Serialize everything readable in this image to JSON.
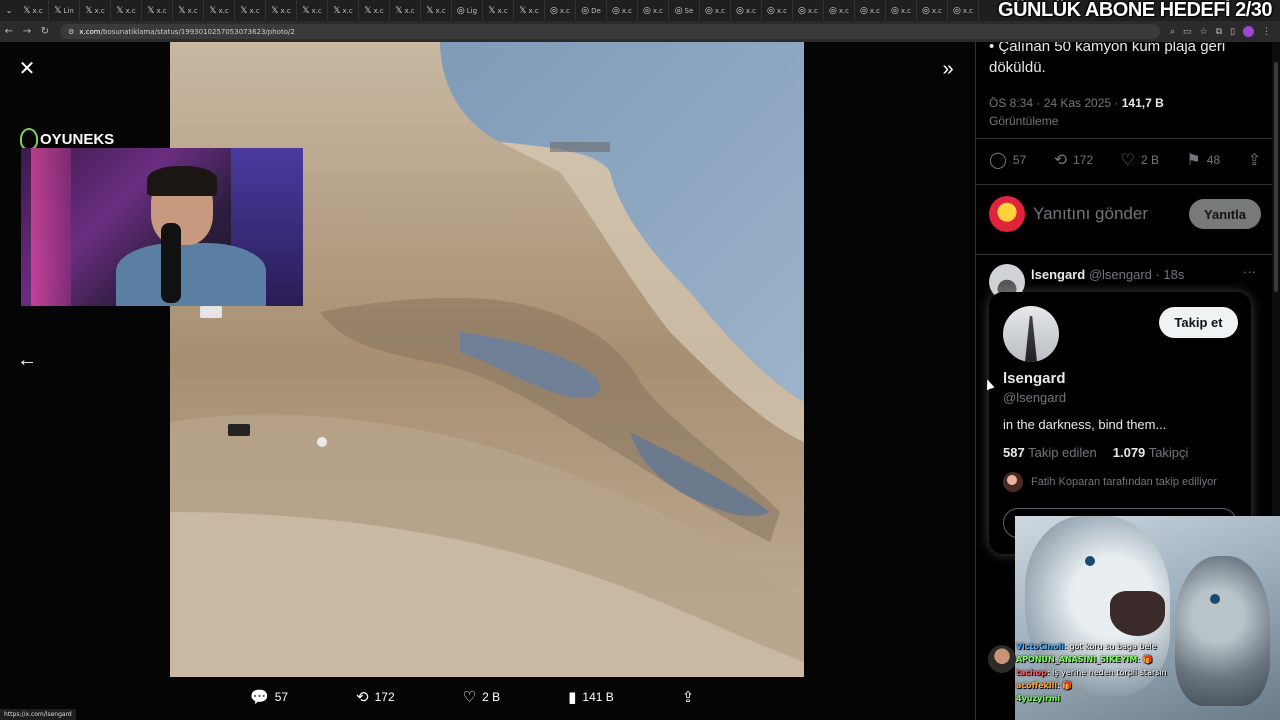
{
  "browser": {
    "tabs": [
      {
        "icon": "x-icon",
        "label": "x.c"
      },
      {
        "icon": "x-icon",
        "label": "Lin"
      },
      {
        "icon": "x-icon",
        "label": "x.c"
      },
      {
        "icon": "x-icon",
        "label": "x.c"
      },
      {
        "icon": "x-icon",
        "label": "x.c"
      },
      {
        "icon": "x-icon",
        "label": "x.c"
      },
      {
        "icon": "x-icon",
        "label": "x.c"
      },
      {
        "icon": "x-icon",
        "label": "x.c"
      },
      {
        "icon": "x-icon",
        "label": "x.c"
      },
      {
        "icon": "x-icon",
        "label": "x.c"
      },
      {
        "icon": "x-icon",
        "label": "x.c"
      },
      {
        "icon": "x-icon",
        "label": "x.c"
      },
      {
        "icon": "x-icon",
        "label": "x.c"
      },
      {
        "icon": "x-icon",
        "label": "x.c"
      },
      {
        "icon": "globe-icon",
        "label": "Lig"
      },
      {
        "icon": "x-icon",
        "label": "x.c"
      },
      {
        "icon": "x-icon",
        "label": "x.c"
      },
      {
        "icon": "globe-icon",
        "label": "x.c"
      },
      {
        "icon": "globe-icon",
        "label": "De"
      },
      {
        "icon": "globe-icon",
        "label": "x.c"
      },
      {
        "icon": "globe-icon",
        "label": "x.c"
      },
      {
        "icon": "globe-icon",
        "label": "Se"
      },
      {
        "icon": "globe-icon",
        "label": "x.c"
      },
      {
        "icon": "globe-icon",
        "label": "x.c"
      },
      {
        "icon": "globe-icon",
        "label": "x.c"
      },
      {
        "icon": "globe-icon",
        "label": "x.c"
      },
      {
        "icon": "globe-icon",
        "label": "x.c"
      },
      {
        "icon": "globe-icon",
        "label": "x.c"
      },
      {
        "icon": "globe-icon",
        "label": "x.c"
      },
      {
        "icon": "globe-icon",
        "label": "x.c"
      },
      {
        "icon": "globe-icon",
        "label": "x.c"
      }
    ],
    "url_host": "x.com",
    "url_path": "/bosunatiklama/status/1993010257053073623/photo/2",
    "status_url": "https://x.com/lsengard"
  },
  "stream_overlay": {
    "goal_banner": "GÜNLÜK ABONE HEDEFİ 2/30",
    "logo_text": "OYUNEKS"
  },
  "viewer": {
    "actions": [
      {
        "icon": "reply-icon",
        "glyph": "💬",
        "count": "57"
      },
      {
        "icon": "retweet-icon",
        "glyph": "⟲",
        "count": "172"
      },
      {
        "icon": "like-icon",
        "glyph": "♡",
        "count": "2 B"
      },
      {
        "icon": "views-icon",
        "glyph": "▮",
        "count": "141 B"
      },
      {
        "icon": "share-icon",
        "glyph": "⇪",
        "count": ""
      }
    ]
  },
  "tweet": {
    "text": "• Çalınan 50 kamyon kum plaja geri döküldü.",
    "time": "ÖS 8:34 · 24 Kas 2025 · ",
    "views_count": "141,7 B",
    "views_label": "Görüntüleme",
    "stats": {
      "replies": "57",
      "retweets": "172",
      "likes": "2 B",
      "bookmarks": "48"
    },
    "reply_placeholder": "Yanıtını gönder",
    "reply_button": "Yanıtla"
  },
  "reply": {
    "name": "lsengard",
    "handle": "@lsengard · 18s",
    "more": "···"
  },
  "hovercard": {
    "follow_button": "Takip et",
    "name": "lsengard",
    "handle": "@lsengard",
    "bio": "in the darkness, bind them...",
    "following_count": "587",
    "following_label": "Takip edilen",
    "followers_count": "1.079",
    "followers_label": "Takipçi",
    "followed_by": "Fatih Koparan tarafından takip ediliyor"
  },
  "chat": [
    {
      "user": "VictoCinoli",
      "color": "#4ab0ff",
      "text": ": got koru su baga bele"
    },
    {
      "user": "APONUN_ANASINI_SIKEYIM",
      "color": "#7dff5a",
      "text": ": 🎁"
    },
    {
      "user": "tachop",
      "color": "#ff5a5a",
      "text": ": iş yerine neden torpil starsın"
    },
    {
      "user": "acoffekill",
      "color": "#ffaa3a",
      "text": ": 🎁"
    },
    {
      "user": "4yuzyirmi",
      "color": "#7dff5a",
      "text": ""
    }
  ]
}
